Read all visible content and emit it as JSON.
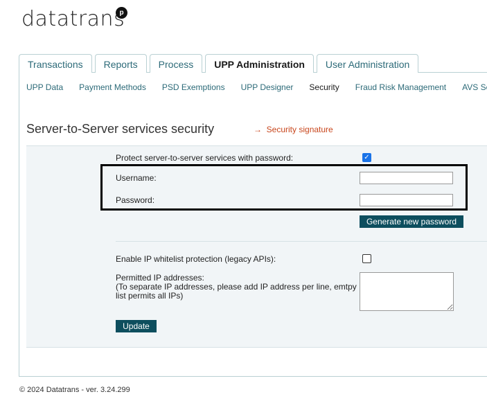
{
  "brand": {
    "name": "datatrans",
    "badge": "p"
  },
  "tabs": [
    {
      "label": "Transactions"
    },
    {
      "label": "Reports"
    },
    {
      "label": "Process"
    },
    {
      "label": "UPP Administration"
    },
    {
      "label": "User Administration"
    }
  ],
  "subnav": [
    {
      "label": "UPP Data"
    },
    {
      "label": "Payment Methods"
    },
    {
      "label": "PSD Exemptions"
    },
    {
      "label": "UPP Designer"
    },
    {
      "label": "Security"
    },
    {
      "label": "Fraud Risk Management"
    },
    {
      "label": "AVS Se"
    }
  ],
  "page": {
    "title": "Server-to-Server services security",
    "link": "Security signature",
    "link_arrow": "→"
  },
  "form": {
    "protect_label": "Protect server-to-server services with password:",
    "protect_checked": true,
    "username_label": "Username:",
    "username_value": "",
    "password_label": "Password:",
    "password_value": "",
    "generate_button": "Generate new password",
    "ip_whitelist_label": "Enable IP whitelist protection (legacy APIs):",
    "ip_whitelist_checked": false,
    "permitted_label": "Permitted IP addresses:",
    "permitted_hint": "(To separate IP addresses, please add IP address per line, emtpy list permits all IPs)",
    "permitted_value": "",
    "update_button": "Update"
  },
  "footer": {
    "text": "© 2024 Datatrans - ver. 3.24.299"
  },
  "colors": {
    "accent": "#0d4e5e",
    "link": "#2c6a78",
    "signature_link": "#c8461c",
    "checkbox": "#1a73e8"
  }
}
